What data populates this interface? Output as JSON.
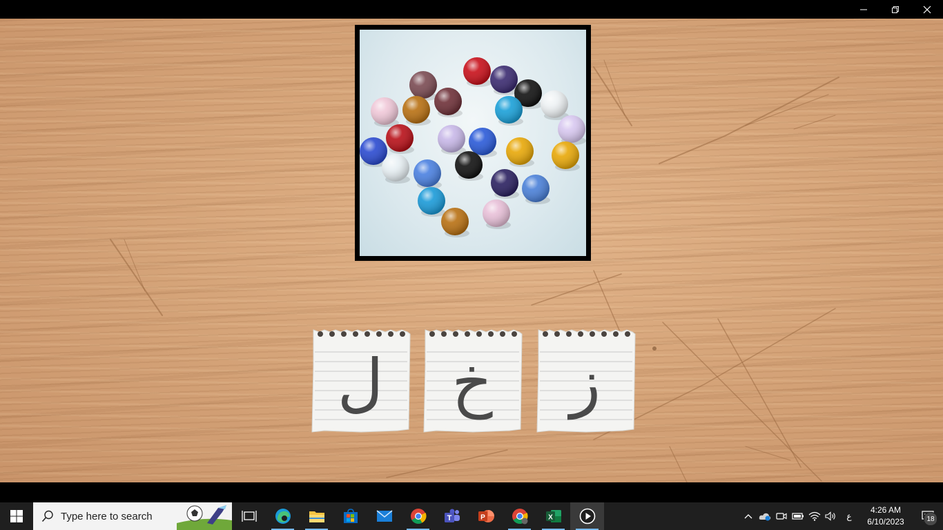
{
  "window": {
    "controls": {
      "minimize": "minimize",
      "restore": "restore",
      "close": "close"
    }
  },
  "game": {
    "picture": {
      "subject": "colorful crystal beads"
    },
    "cards": [
      {
        "letter": "ل"
      },
      {
        "letter": "خ"
      },
      {
        "letter": "ز"
      }
    ]
  },
  "taskbar": {
    "search_placeholder": "Type here to search",
    "apps": [
      {
        "name": "task-view-icon"
      },
      {
        "name": "edge-icon"
      },
      {
        "name": "file-explorer-icon"
      },
      {
        "name": "microsoft-store-icon"
      },
      {
        "name": "mail-icon"
      },
      {
        "name": "chrome-icon"
      },
      {
        "name": "teams-icon"
      },
      {
        "name": "powerpoint-icon"
      },
      {
        "name": "chrome-profile-icon"
      },
      {
        "name": "excel-icon"
      },
      {
        "name": "media-player-icon"
      }
    ],
    "tray": {
      "language": "ع",
      "time": "4:26 AM",
      "date": "6/10/2023",
      "notification_count": "18"
    }
  },
  "colors": {
    "wood": "#d6a57a",
    "frame": "#000000",
    "taskbar": "#1f1f1f",
    "letter": "#4a4a4a"
  }
}
